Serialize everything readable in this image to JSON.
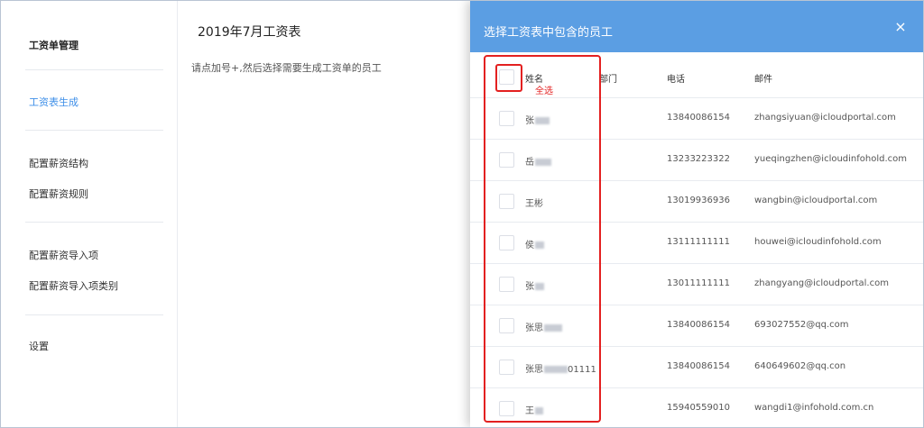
{
  "sidebar": {
    "items": [
      {
        "label": "工资单管理",
        "type": "head"
      },
      {
        "label": "工资表生成",
        "type": "active"
      },
      {
        "label": "配置薪资结构",
        "type": "normal"
      },
      {
        "label": "配置薪资规则",
        "type": "normal"
      },
      {
        "label": "配置薪资导入项",
        "type": "normal"
      },
      {
        "label": "配置薪资导入项类别",
        "type": "normal"
      },
      {
        "label": "设置",
        "type": "normal"
      }
    ]
  },
  "main": {
    "title": "2019年7月工资表",
    "hint": "请点加号+,然后选择需要生成工资单的员工"
  },
  "dialog": {
    "title": "选择工资表中包含的员工",
    "close_icon": "×",
    "columns": {
      "name": "姓名",
      "dept": "部门",
      "phone": "电话",
      "email": "邮件"
    },
    "select_all_annotation": "全选",
    "rows": [
      {
        "name": "张",
        "phone": "13840086154",
        "email": "zhangsiyuan@icloudportal.com"
      },
      {
        "name": "岳",
        "phone": "13233223322",
        "email": "yueqingzhen@icloudinfohold.com"
      },
      {
        "name": "王彬",
        "phone": "13019936936",
        "email": "wangbin@icloudportal.com"
      },
      {
        "name": "侯",
        "phone": "13111111111",
        "email": "houwei@icloudinfohold.com"
      },
      {
        "name": "张",
        "phone": "13011111111",
        "email": "zhangyang@icloudportal.com"
      },
      {
        "name": "张思",
        "phone": "13840086154",
        "email": "693027552@qq.com"
      },
      {
        "name": "张思",
        "name_suffix": "01111",
        "phone": "13840086154",
        "email": "640649602@qq.con"
      },
      {
        "name": "王",
        "phone": "15940559010",
        "email": "wangdi1@infohold.com.cn"
      }
    ]
  },
  "colors": {
    "accent": "#3f8fe8",
    "header_bg": "#5b9ee3",
    "annotation": "#e32020"
  }
}
